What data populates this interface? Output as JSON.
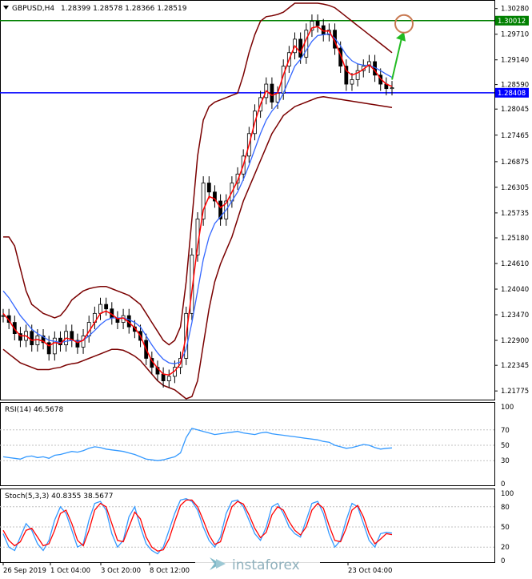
{
  "header": {
    "symbol": "GBPUSD,H4",
    "ohlc": "1.28399 1.28578 1.28366 1.28519",
    "dropdown_arrow": "triangle-down-icon"
  },
  "colors": {
    "background": "#ffffff",
    "candle": "#000000",
    "bb_outer": "#7a0000",
    "ma_fast": "#ff0000",
    "ma_slow": "#3366ff",
    "resistance_line": "#008000",
    "support_line": "#0000ff",
    "forecast_arrow": "#22bb22",
    "target_circle": "#c87850",
    "rsi_line": "#3399ff",
    "stoch_main": "#3399ff",
    "stoch_signal": "#ff0000",
    "price_tag_green": "#008000",
    "price_tag_blue": "#0000ff"
  },
  "price_axis": {
    "labels": [
      "1.30280",
      "1.29710",
      "1.29140",
      "1.28590",
      "1.28045",
      "1.27465",
      "1.26875",
      "1.26305",
      "1.25735",
      "1.25180",
      "1.24610",
      "1.24040",
      "1.23470",
      "1.22900",
      "1.22345",
      "1.21775"
    ],
    "resistance_tag": "1.30012",
    "support_tag": "1.28408",
    "current_tag_partial": "1.28590"
  },
  "time_axis": {
    "labels": [
      "26 Sep 2019",
      "1 Oct 04:00",
      "3 Oct 20:00",
      "8 Oct 12:00",
      "",
      "",
      "",
      "",
      "23 Oct 04:00"
    ]
  },
  "rsi_panel": {
    "title": "RSI(14) 46.5678",
    "levels": [
      "100",
      "70",
      "50",
      "30",
      "0"
    ]
  },
  "stoch_panel": {
    "title": "Stoch(5,3,3) 40.8355 38.5677",
    "levels": [
      "100",
      "80",
      "50",
      "20",
      "0"
    ]
  },
  "watermark": {
    "text": "instaforex",
    "logo": "instaforex-logo-icon"
  },
  "chart_data": {
    "type": "line",
    "symbol": "GBPUSD",
    "timeframe": "H4",
    "ylim": [
      1.216,
      1.304
    ],
    "resistance_level": 1.30012,
    "support_level": 1.28408,
    "close_series": [
      1.2345,
      1.233,
      1.2305,
      1.229,
      1.231,
      1.228,
      1.23,
      1.2285,
      1.226,
      1.2295,
      1.228,
      1.231,
      1.229,
      1.2275,
      1.23,
      1.233,
      1.235,
      1.237,
      1.236,
      1.234,
      1.233,
      1.2345,
      1.232,
      1.231,
      1.229,
      1.225,
      1.223,
      1.2215,
      1.22,
      1.221,
      1.223,
      1.225,
      1.235,
      1.248,
      1.256,
      1.264,
      1.262,
      1.26,
      1.256,
      1.26,
      1.264,
      1.266,
      1.27,
      1.275,
      1.28,
      1.283,
      1.286,
      1.282,
      1.284,
      1.29,
      1.293,
      1.296,
      1.292,
      1.298,
      1.3,
      1.299,
      1.297,
      1.298,
      1.294,
      1.29,
      1.286,
      1.287,
      1.289,
      1.29,
      1.291,
      1.288,
      1.286,
      1.285,
      1.2852
    ],
    "ma_fast": [
      1.235,
      1.2335,
      1.2315,
      1.23,
      1.23,
      1.229,
      1.2292,
      1.2288,
      1.2278,
      1.2285,
      1.2283,
      1.2295,
      1.2292,
      1.2285,
      1.229,
      1.231,
      1.233,
      1.235,
      1.2355,
      1.2348,
      1.2338,
      1.234,
      1.233,
      1.2318,
      1.23,
      1.227,
      1.2245,
      1.2228,
      1.2215,
      1.2213,
      1.2222,
      1.2238,
      1.23,
      1.24,
      1.25,
      1.258,
      1.261,
      1.2605,
      1.2585,
      1.2595,
      1.262,
      1.2645,
      1.268,
      1.2725,
      1.2775,
      1.2815,
      1.2845,
      1.2835,
      1.284,
      1.288,
      1.2915,
      1.2945,
      1.293,
      1.296,
      1.2985,
      1.2988,
      1.2978,
      1.2978,
      1.2955,
      1.2925,
      1.289,
      1.288,
      1.2885,
      1.2893,
      1.2903,
      1.289,
      1.2872,
      1.286,
      1.2855
    ],
    "ma_slow": [
      1.24,
      1.2385,
      1.2365,
      1.2345,
      1.233,
      1.2315,
      1.2305,
      1.2298,
      1.229,
      1.2288,
      1.2285,
      1.2288,
      1.229,
      1.2288,
      1.229,
      1.23,
      1.2312,
      1.2325,
      1.2335,
      1.234,
      1.234,
      1.234,
      1.2336,
      1.233,
      1.232,
      1.23,
      1.228,
      1.2262,
      1.2248,
      1.224,
      1.2238,
      1.2242,
      1.227,
      1.233,
      1.24,
      1.247,
      1.252,
      1.255,
      1.2565,
      1.258,
      1.26,
      1.262,
      1.2648,
      1.268,
      1.2715,
      1.275,
      1.278,
      1.28,
      1.2815,
      1.284,
      1.287,
      1.29,
      1.2915,
      1.2935,
      1.2955,
      1.2968,
      1.297,
      1.2972,
      1.2962,
      1.2945,
      1.2925,
      1.2912,
      1.2905,
      1.2902,
      1.2902,
      1.2897,
      1.289,
      1.2882,
      1.2875
    ],
    "bb_upper": [
      1.252,
      1.252,
      1.25,
      1.245,
      1.24,
      1.237,
      1.236,
      1.235,
      1.2345,
      1.234,
      1.2345,
      1.236,
      1.238,
      1.239,
      1.24,
      1.2405,
      1.2408,
      1.241,
      1.241,
      1.2405,
      1.24,
      1.2395,
      1.239,
      1.238,
      1.237,
      1.235,
      1.233,
      1.231,
      1.229,
      1.228,
      1.229,
      1.232,
      1.242,
      1.256,
      1.27,
      1.278,
      1.281,
      1.282,
      1.2825,
      1.283,
      1.2835,
      1.284,
      1.288,
      1.293,
      1.297,
      1.3,
      1.301,
      1.3012,
      1.3015,
      1.302,
      1.303,
      1.304,
      1.304,
      1.304,
      1.304,
      1.304,
      1.3038,
      1.3035,
      1.303,
      1.302,
      1.301,
      1.3,
      1.299,
      1.298,
      1.297,
      1.296,
      1.295,
      1.294,
      1.293
    ],
    "bb_lower": [
      1.227,
      1.226,
      1.225,
      1.224,
      1.2235,
      1.223,
      1.2225,
      1.2225,
      1.2225,
      1.2228,
      1.223,
      1.2235,
      1.2238,
      1.224,
      1.2245,
      1.225,
      1.2255,
      1.226,
      1.2265,
      1.227,
      1.227,
      1.2268,
      1.2262,
      1.2255,
      1.2245,
      1.223,
      1.2215,
      1.22,
      1.219,
      1.2185,
      1.218,
      1.217,
      1.216,
      1.2165,
      1.22,
      1.228,
      1.236,
      1.242,
      1.246,
      1.249,
      1.252,
      1.256,
      1.26,
      1.263,
      1.266,
      1.269,
      1.272,
      1.275,
      1.277,
      1.279,
      1.28,
      1.281,
      1.2815,
      1.282,
      1.2825,
      1.283,
      1.2832,
      1.283,
      1.2828,
      1.2826,
      1.2824,
      1.2822,
      1.282,
      1.2818,
      1.2816,
      1.2814,
      1.2812,
      1.281,
      1.2808
    ],
    "rsi": [
      35,
      34,
      33,
      32,
      35,
      36,
      34,
      35,
      33,
      37,
      38,
      40,
      42,
      41,
      43,
      46,
      48,
      47,
      45,
      44,
      43,
      42,
      40,
      38,
      35,
      32,
      31,
      30,
      31,
      33,
      35,
      40,
      60,
      72,
      70,
      68,
      66,
      64,
      65,
      66,
      67,
      68,
      66,
      65,
      64,
      66,
      67,
      65,
      64,
      63,
      62,
      61,
      60,
      59,
      58,
      57,
      55,
      54,
      50,
      48,
      46,
      47,
      49,
      51,
      50,
      47,
      45,
      46,
      46.5678
    ],
    "stoch_main": [
      40,
      20,
      15,
      35,
      55,
      45,
      25,
      15,
      30,
      60,
      80,
      70,
      45,
      20,
      25,
      60,
      85,
      88,
      75,
      40,
      20,
      30,
      65,
      80,
      50,
      25,
      15,
      10,
      20,
      45,
      70,
      90,
      92,
      88,
      75,
      50,
      30,
      20,
      35,
      70,
      88,
      90,
      80,
      60,
      40,
      30,
      50,
      80,
      85,
      70,
      50,
      40,
      35,
      60,
      85,
      88,
      70,
      40,
      20,
      30,
      60,
      85,
      80,
      55,
      30,
      20,
      40,
      42,
      40.8355
    ],
    "stoch_signal": [
      45,
      30,
      22,
      28,
      45,
      48,
      35,
      22,
      25,
      45,
      70,
      75,
      55,
      30,
      22,
      45,
      75,
      85,
      80,
      55,
      30,
      28,
      50,
      72,
      62,
      35,
      20,
      14,
      16,
      32,
      58,
      82,
      90,
      90,
      80,
      60,
      38,
      24,
      28,
      55,
      80,
      88,
      84,
      68,
      48,
      34,
      42,
      68,
      80,
      75,
      58,
      45,
      38,
      50,
      75,
      85,
      78,
      52,
      30,
      28,
      48,
      75,
      82,
      65,
      40,
      25,
      32,
      40,
      38.5677
    ]
  }
}
